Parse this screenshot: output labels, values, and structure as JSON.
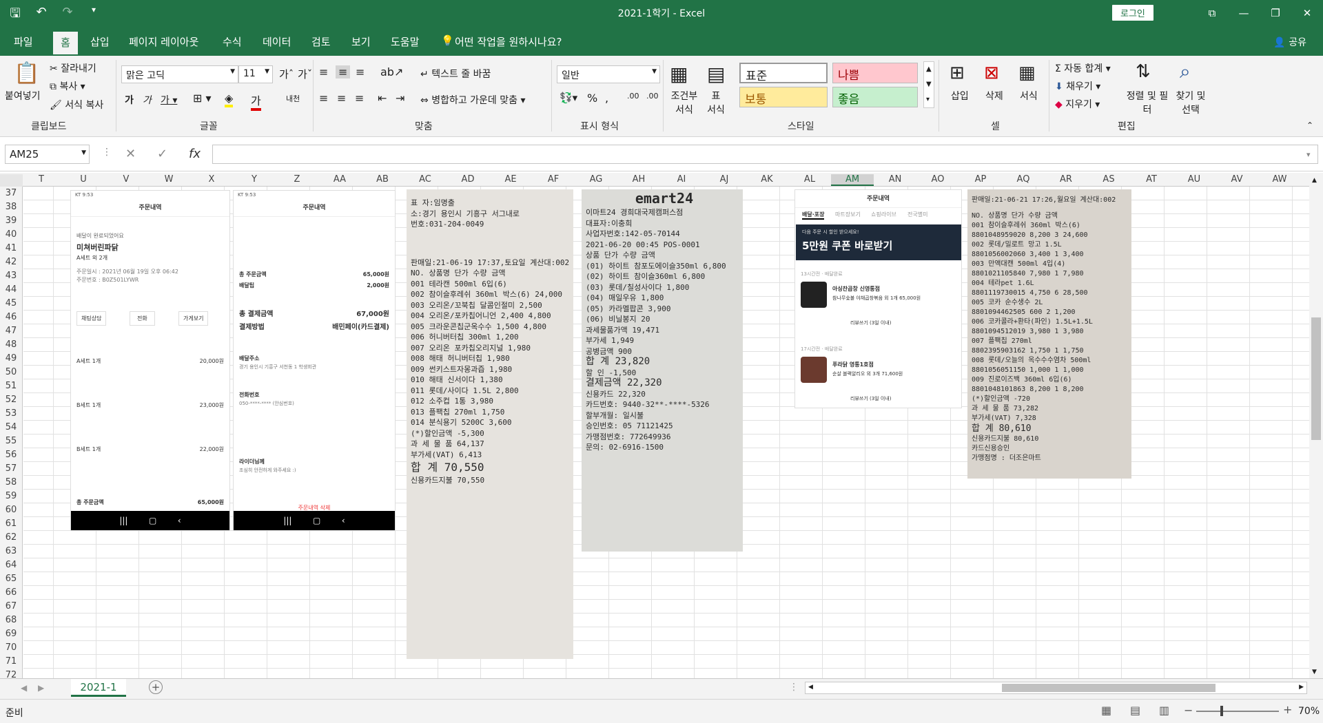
{
  "window": {
    "title": "2021-1학기  -  Excel",
    "signin": "로그인"
  },
  "tabs": [
    "파일",
    "홈",
    "삽입",
    "페이지 레이아웃",
    "수식",
    "데이터",
    "검토",
    "보기",
    "도움말",
    "어떤 작업을 원하시나요?"
  ],
  "share": "공유",
  "ribbon": {
    "paste": "붙여넣기",
    "cut": "잘라내기",
    "copy": "복사",
    "format_painter": "서식 복사",
    "clipboard": "클립보드",
    "font_name": "맑은 고딕",
    "font_size": "11",
    "font_group": "글꼴",
    "wrap_text": "텍스트 줄 바꿈",
    "merge_center": "병합하고 가운데 맞춤",
    "alignment": "맞춤",
    "number_format": "일반",
    "number_group": "표시 형식",
    "cond_format": "조건부 서식",
    "table_format": "표 서식",
    "style_normal": "표준",
    "style_bad": "나쁨",
    "style_neutral": "보통",
    "style_good": "좋음",
    "styles": "스타일",
    "insert": "삽입",
    "delete": "삭제",
    "format": "서식",
    "cells": "셀",
    "autosum": "자동 합계",
    "fill": "채우기",
    "clear": "지우기",
    "sort_filter": "정렬 및 필터",
    "find_select": "찾기 및 선택",
    "editing": "편집"
  },
  "formula_bar": {
    "name_box": "AM25",
    "value": ""
  },
  "columns": [
    "T",
    "U",
    "V",
    "W",
    "X",
    "Y",
    "Z",
    "AA",
    "AB",
    "AC",
    "AD",
    "AE",
    "AF",
    "AG",
    "AH",
    "AI",
    "AJ",
    "AK",
    "AL",
    "AM",
    "AN",
    "AO",
    "AP",
    "AQ",
    "AR",
    "AS",
    "AT",
    "AU",
    "AV",
    "AW"
  ],
  "rows": [
    "37",
    "38",
    "39",
    "40",
    "41",
    "42",
    "43",
    "44",
    "45",
    "46",
    "47",
    "48",
    "49",
    "50",
    "51",
    "52",
    "53",
    "54",
    "55",
    "56",
    "57",
    "58",
    "59",
    "60",
    "61",
    "62",
    "63",
    "64",
    "65",
    "66",
    "67",
    "68",
    "69",
    "70",
    "71",
    "72"
  ],
  "sheet_tab": "2021-1",
  "status": {
    "ready": "준비",
    "zoom": "70%"
  },
  "phone1": {
    "status": "KT 9:53",
    "header": "주문내역",
    "delivered": "배달이 완료되었어요",
    "store": "미쳐버린파닭",
    "summary": "A세트 외 2개",
    "order_time": "주문일시 : 2021년 06월 19일 오후 06:42",
    "order_no": "주문번호 : B0Z501LYWR",
    "chat": "채팅상담",
    "call": "전화",
    "store_btn": "가게보기",
    "item1": "A세트 1개",
    "item1_price": "20,000원",
    "item2": "B세트 1개",
    "item2_price": "23,000원",
    "item3": "B세트 1개",
    "item3_price": "22,000원",
    "total_label": "총 주문금액",
    "total": "65,000원"
  },
  "phone2": {
    "status": "KT 9:53",
    "header": "주문내역",
    "sum_label": "총 주문금액",
    "sum": "65,000원",
    "delivery_label": "배달팁",
    "delivery": "2,000원",
    "pay_label": "총 결제금액",
    "pay": "67,000원",
    "method_label": "결제방법",
    "method": "배민페이(카드결제)",
    "addr_label": "배달주소",
    "addr": "경기 용인시 기흥구 서천동 1 학생회관",
    "phone_label": "전화번호",
    "phone": "050-****-**** (안심번호)",
    "rider_label": "라이더님께",
    "rider": "조심히 안전하게 와주세요 :)",
    "delete": "주문내역 삭제"
  },
  "phone3": {
    "header": "주문내역",
    "tab1": "배달·포장",
    "tab2": "마트장보기",
    "tab3": "쇼핑라이브",
    "tab4": "전국별미",
    "banner": "5만원 쿠폰 바로받기",
    "banner_sub": "다음 주문 시 할인 받으세요!",
    "o1_meta": "13시간전 · 배달완료",
    "o1_store": "아싱찬곱창 신영통점",
    "o1_desc": "참나무숯불 야채곱창볶음 외 1개 65,000원",
    "o1_review": "리뷰쓰기 (3일 이내)",
    "o2_meta": "17시간전 · 배달완료",
    "o2_store": "푸라닭 영통1호점",
    "o2_desc": "순살 블랙알리오 외 3개 71,600원",
    "o2_review": "리뷰쓰기 (3일 이내)"
  },
  "receipt1": [
    "표 자:임명출",
    "소:경기 용인시 기흥구 서그내로",
    "번호:031-204-0049",
    "판매일:21-06-19 17:37,토요일 계산대:002",
    "NO. 상품명  단가 수량 금액",
    "001 테라캔 500ml 6입(6)",
    "002 참이슬후레쉬 360ml 박스(6)  24,000",
    "003 오리온/꼬북칩 달콤인절미  2,500",
    "004 오리온/포카칩어니언  2,400  4,800",
    "005 크라운콘칩군옥수수  1,500  4,800",
    "006 허니버터칩 300ml  1,200",
    "007 오리온 포카칩오리지널  1,980",
    "008 해태 허니버터칩  1,980",
    "009 썬키스트자몽과즙  1,980",
    "010 해태 신서이다  1,380",
    "011 롯데/사이다 1.5L  2,800",
    "012 소주컵 1통  3,980",
    "013 플팩칩 270ml  1,750",
    "014 분식용기 5200C  3,600",
    "(*)할인금액  -5,300",
    "과 세 물 품  64,137",
    "부가세(VAT)  6,413",
    "합 계  70,550",
    "신용카드지불  70,550"
  ],
  "receipt2": [
    "이마트24 경희대국제캠퍼스점",
    "대표자:이충희",
    "사업자번호:142-05-70144",
    "2021-06-20 00:45 POS-0001",
    "상품   단가 수량  금액",
    "(01) 하이트 참포도에이슬350ml  6,800",
    "(02) 하이트 참이슬360ml  6,800",
    "(03) 롯데/칠성사이다  1,800",
    "(04) 매일우유  1,800",
    "(05) 카라멜팝콘  3,900",
    "(06) 비닐봉지  20",
    "과세물품가액  19,471",
    "부가세  1,949",
    "공병금액  900",
    "합 계  23,820",
    "할 인  -1,500",
    "결제금액  22,320",
    "신용카드  22,320",
    "카드번호: 9440-32**-****-5326",
    "할부개월: 일시불",
    "승인번호: 05 71121425",
    "가맹점번호: 772649936",
    "문의: 02-6916-1500"
  ],
  "receipt3": [
    "판매일:21-06-21 17:26,월요일 계산대:002",
    "NO. 상품명  단가 수량 금액",
    "001 참이슬후레쉬 360ml 박스(6)",
    "8801048959020 8,200  3  24,600",
    "002 롯데/밀로트 망고 1.5L",
    "8801056002060 3,400  1  3,400",
    "003 만액대캔 500ml 4입(4)",
    "8801021105840 7,980  1  7,980",
    "004 테라pet 1.6L",
    "8801119730015 4,750  6  28,500",
    "005 코카 순수생수 2L",
    "8801094462505 600  2  1,200",
    "006 코카콜라+환타(파인) 1.5L+1.5L",
    "8801094512019 3,980  1  3,980",
    "007 플팩칩 270ml",
    "8802395903162 1,750  1  1,750",
    "008 롯데/오늘의 옥수수수염차 500ml",
    "8801056051150 1,000  1  1,000",
    "009 진로이즈백 360ml 6입(6)",
    "8801048101863 8,200  1  8,200",
    "(*)할인금액  -720",
    "과 세 물 품  73,282",
    "부가세(VAT)  7,328",
    "합 계  80,610",
    "신용카드지불  80,610",
    "카드신용승인",
    "가맹점명 : 더조은마트"
  ]
}
